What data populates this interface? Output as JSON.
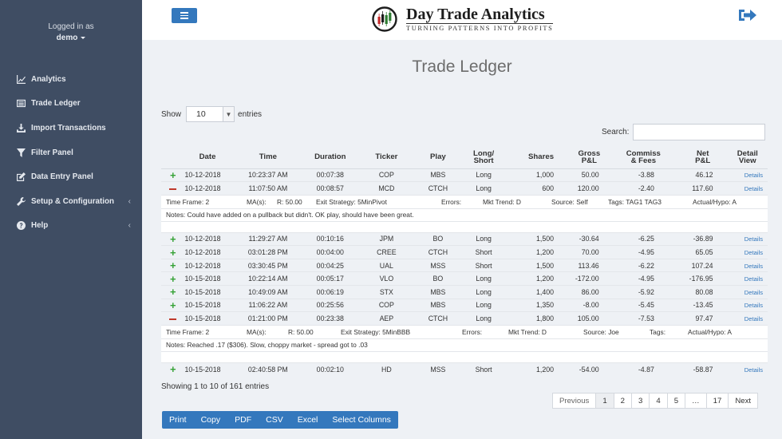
{
  "user": {
    "logged_in_label": "Logged in as",
    "name": "demo"
  },
  "sidebar": {
    "items": [
      {
        "label": "Analytics",
        "icon": "line-chart-icon"
      },
      {
        "label": "Trade Ledger",
        "icon": "list-icon"
      },
      {
        "label": "Import Transactions",
        "icon": "download-icon"
      },
      {
        "label": "Filter Panel",
        "icon": "filter-icon"
      },
      {
        "label": "Data Entry Panel",
        "icon": "edit-icon"
      },
      {
        "label": "Setup & Configuration",
        "icon": "wrench-icon",
        "chevron": "‹"
      },
      {
        "label": "Help",
        "icon": "question-icon",
        "chevron": "‹"
      }
    ]
  },
  "header": {
    "brand_title": "Day Trade Analytics",
    "brand_tagline": "TURNING PATTERNS INTO PROFITS",
    "accent_color": "#3478bd"
  },
  "page": {
    "title": "Trade Ledger"
  },
  "controls": {
    "show_label": "Show",
    "entries_value": "10",
    "entries_label": "entries",
    "search_label": "Search:",
    "search_value": ""
  },
  "table": {
    "headers": {
      "date": "Date",
      "time": "Time",
      "duration": "Duration",
      "ticker": "Ticker",
      "play": "Play",
      "long_short_1": "Long/",
      "long_short_2": "Short",
      "shares": "Shares",
      "gross_1": "Gross",
      "gross_2": "P&L",
      "comm_1": "Commiss",
      "comm_2": "& Fees",
      "net_1": "Net",
      "net_2": "P&L",
      "detail_1": "Detail",
      "detail_2": "View"
    },
    "rows": [
      {
        "toggle": "+",
        "date": "10-12-2018",
        "time": "10:23:37 AM",
        "duration": "00:07:38",
        "ticker": "COP",
        "play": "MBS",
        "side": "Long",
        "shares": "1,000",
        "gross": "50.00",
        "comm": "-3.88",
        "net": "46.12",
        "details": "Details"
      },
      {
        "toggle": "−",
        "date": "10-12-2018",
        "time": "11:07:50 AM",
        "duration": "00:08:57",
        "ticker": "MCD",
        "play": "CTCH",
        "side": "Long",
        "shares": "600",
        "gross": "120.00",
        "comm": "-2.40",
        "net": "117.60",
        "details": "Details",
        "info": {
          "timeframe": "Time Frame: 2",
          "ma": "MA(s):",
          "r": "R: 50.00",
          "exit": "Exit Strategy: 5MinPivot",
          "errors": "Errors:",
          "trend": "Mkt Trend: D",
          "source": "Source: Self",
          "tags": "Tags: TAG1 TAG3",
          "actual": "Actual/Hypo: A"
        },
        "notes": "Notes: Could have added on a pullback but didn't. OK play, should have been great."
      },
      {
        "toggle": "+",
        "date": "10-12-2018",
        "time": "11:29:27 AM",
        "duration": "00:10:16",
        "ticker": "JPM",
        "play": "BO",
        "side": "Long",
        "shares": "1,500",
        "gross": "-30.64",
        "comm": "-6.25",
        "net": "-36.89",
        "details": "Details"
      },
      {
        "toggle": "+",
        "date": "10-12-2018",
        "time": "03:01:28 PM",
        "duration": "00:04:00",
        "ticker": "CREE",
        "play": "CTCH",
        "side": "Short",
        "shares": "1,200",
        "gross": "70.00",
        "comm": "-4.95",
        "net": "65.05",
        "details": "Details"
      },
      {
        "toggle": "+",
        "date": "10-12-2018",
        "time": "03:30:45 PM",
        "duration": "00:04:25",
        "ticker": "UAL",
        "play": "MSS",
        "side": "Short",
        "shares": "1,500",
        "gross": "113.46",
        "comm": "-6.22",
        "net": "107.24",
        "details": "Details"
      },
      {
        "toggle": "+",
        "date": "10-15-2018",
        "time": "10:22:14 AM",
        "duration": "00:05:17",
        "ticker": "VLO",
        "play": "BO",
        "side": "Long",
        "shares": "1,200",
        "gross": "-172.00",
        "comm": "-4.95",
        "net": "-176.95",
        "details": "Details"
      },
      {
        "toggle": "+",
        "date": "10-15-2018",
        "time": "10:49:09 AM",
        "duration": "00:06:19",
        "ticker": "STX",
        "play": "MBS",
        "side": "Long",
        "shares": "1,400",
        "gross": "86.00",
        "comm": "-5.92",
        "net": "80.08",
        "details": "Details"
      },
      {
        "toggle": "+",
        "date": "10-15-2018",
        "time": "11:06:22 AM",
        "duration": "00:25:56",
        "ticker": "COP",
        "play": "MBS",
        "side": "Long",
        "shares": "1,350",
        "gross": "-8.00",
        "comm": "-5.45",
        "net": "-13.45",
        "details": "Details"
      },
      {
        "toggle": "−",
        "date": "10-15-2018",
        "time": "01:21:00 PM",
        "duration": "00:23:38",
        "ticker": "AEP",
        "play": "CTCH",
        "side": "Long",
        "shares": "1,800",
        "gross": "105.00",
        "comm": "-7.53",
        "net": "97.47",
        "details": "Details",
        "info": {
          "timeframe": "Time Frame: 2",
          "ma": "MA(s):",
          "r": "R: 50.00",
          "exit": "Exit Strategy: 5MinBBB",
          "errors": "Errors:",
          "trend": "Mkt Trend: D",
          "source": "Source: Joe",
          "tags": "Tags:",
          "actual": "Actual/Hypo: A"
        },
        "notes": "Notes: Reached .17 ($306). Slow, choppy market - spread got to .03"
      },
      {
        "toggle": "+",
        "date": "10-15-2018",
        "time": "02:40:58 PM",
        "duration": "00:02:10",
        "ticker": "HD",
        "play": "MSS",
        "side": "Short",
        "shares": "1,200",
        "gross": "-54.00",
        "comm": "-4.87",
        "net": "-58.87",
        "details": "Details"
      }
    ]
  },
  "footer": {
    "showing": "Showing 1 to 10 of 161 entries",
    "pagination": [
      "Previous",
      "1",
      "2",
      "3",
      "4",
      "5",
      "…",
      "17",
      "Next"
    ],
    "export_buttons": [
      "Print",
      "Copy",
      "PDF",
      "CSV",
      "Excel",
      "Select Columns"
    ]
  }
}
